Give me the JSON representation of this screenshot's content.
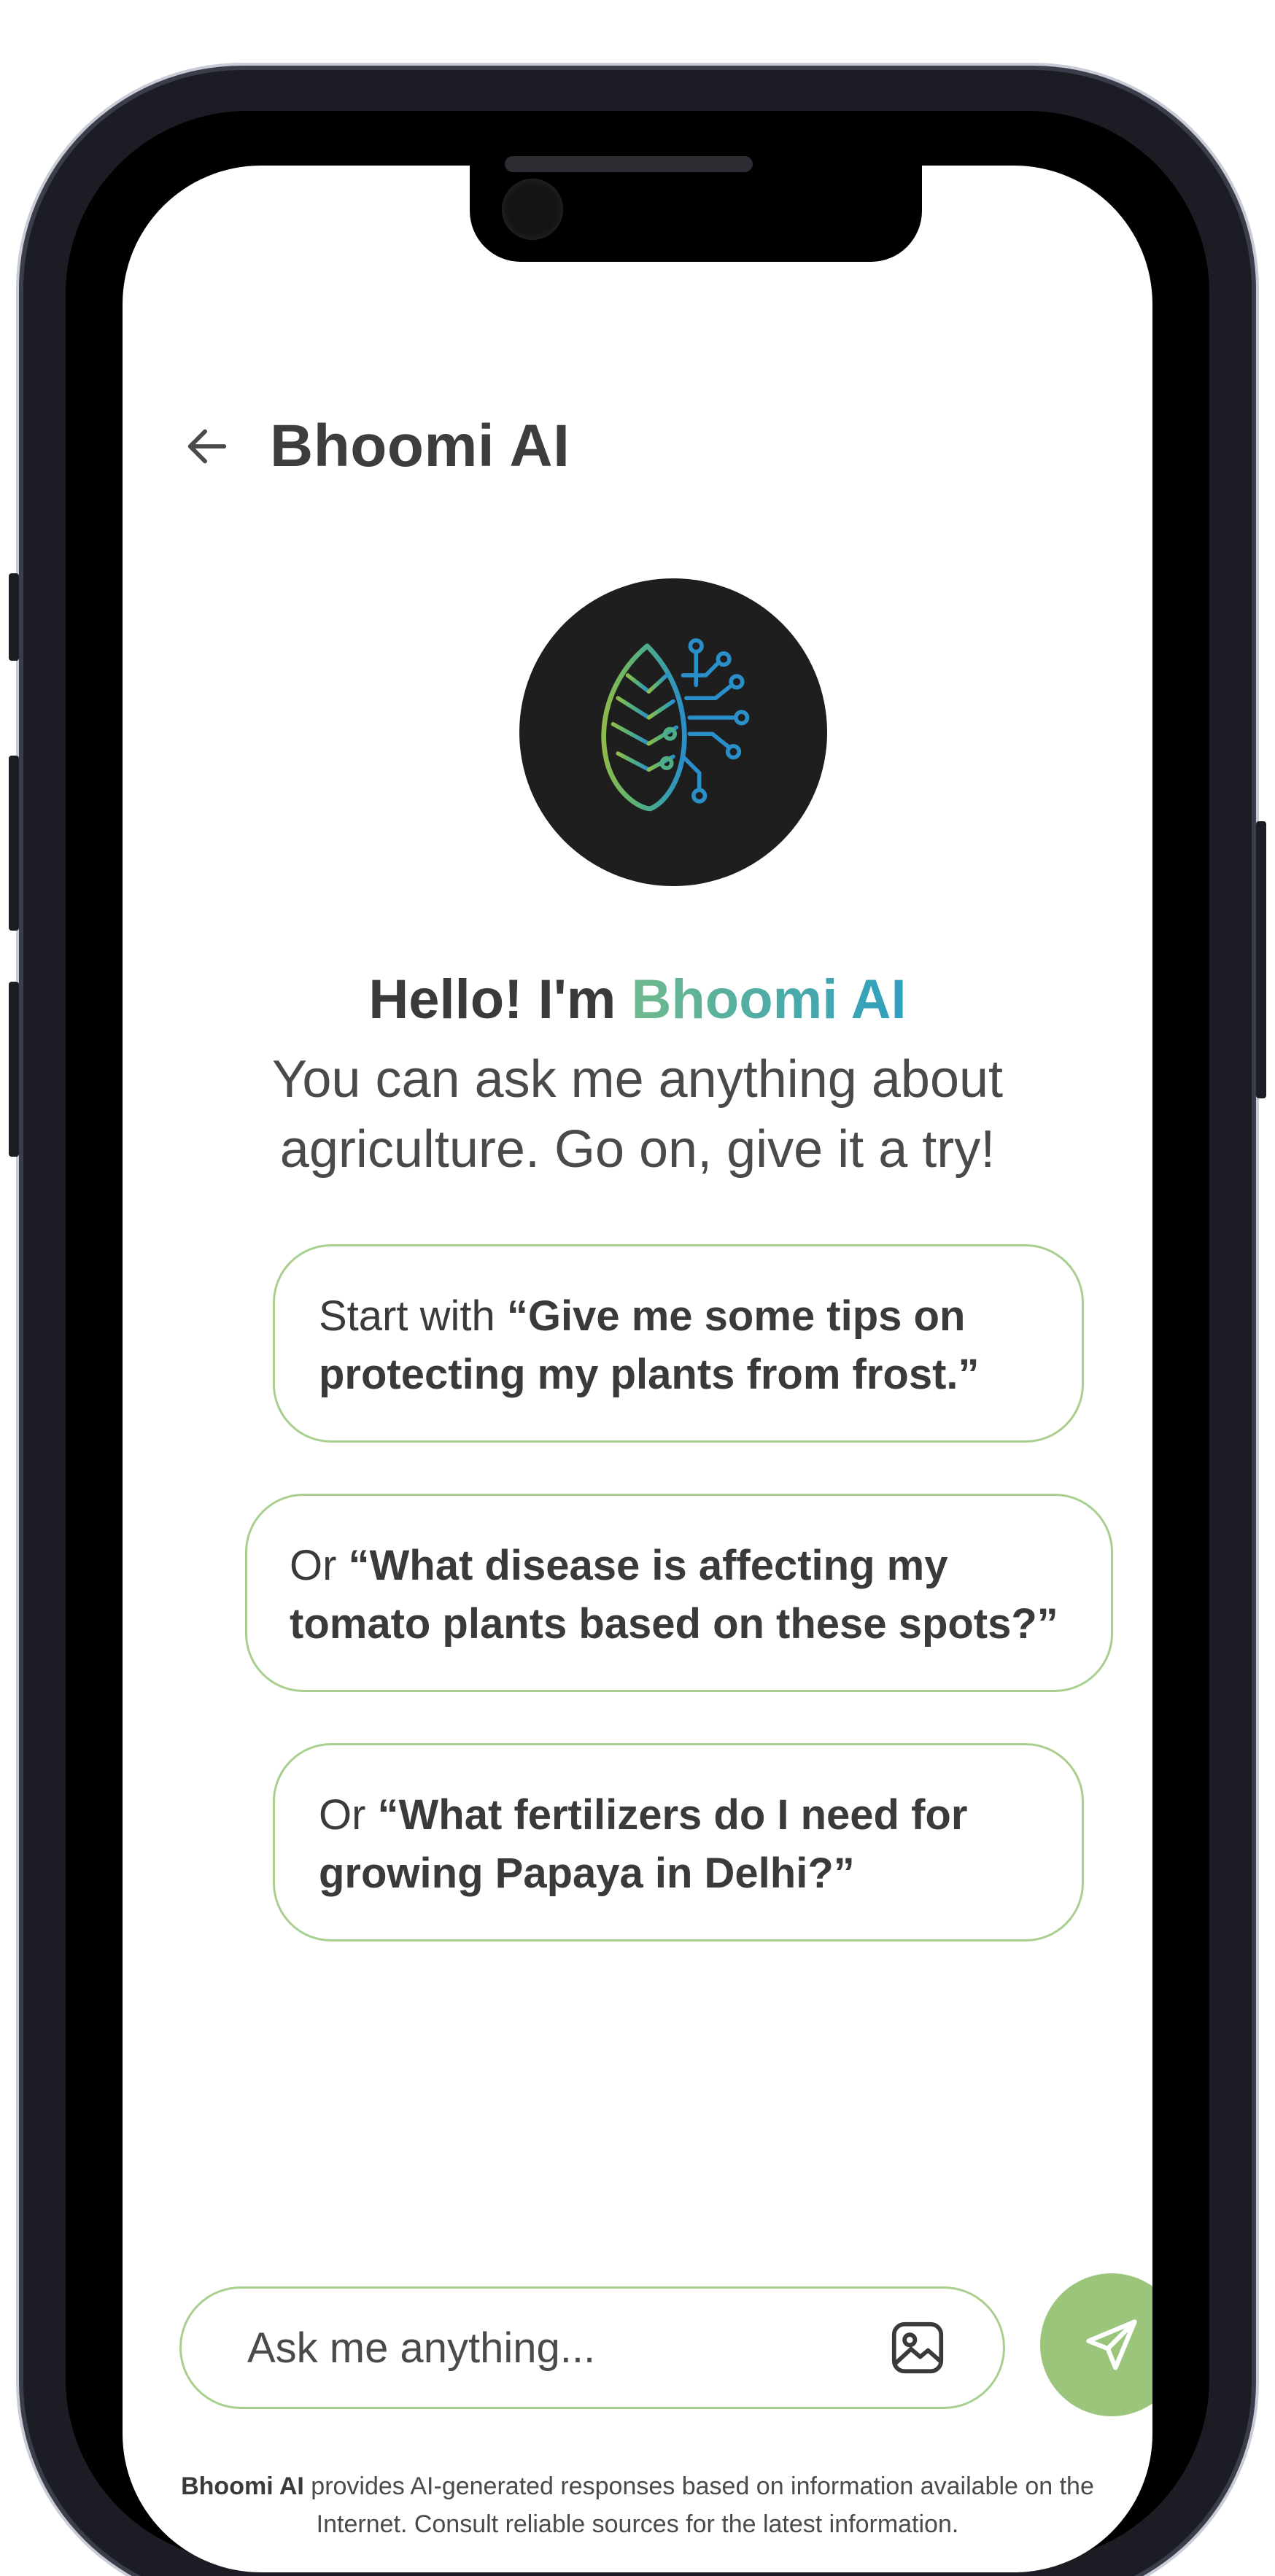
{
  "header": {
    "title": "Bhoomi AI"
  },
  "greeting": {
    "prefix": "Hello! I'm ",
    "brand": "Bhoomi AI",
    "intro": "You can ask me anything about agriculture. Go on, give it a try!"
  },
  "suggestions": [
    {
      "prefix": "Start with ",
      "quote": "“Give me some tips on protecting my plants from frost.”"
    },
    {
      "prefix": "Or ",
      "quote": "“What disease is affecting my tomato plants based on these spots?”"
    },
    {
      "prefix": "Or ",
      "quote": "“What fertilizers do I need for growing Papaya in Delhi?”"
    }
  ],
  "input": {
    "placeholder": "Ask me anything..."
  },
  "disclaimer": {
    "brand": "Bhoomi AI",
    "text": " provides AI-generated responses based on information available on the Internet. Consult reliable sources for the latest information."
  },
  "colors": {
    "accent_green": "#9cc57c",
    "card_border": "#a9cf8e",
    "brand_gradient_start": "#6fb98c",
    "brand_gradient_end": "#2f9fbf",
    "avatar_bg": "#1e1e1e"
  },
  "icons": {
    "back": "arrow-left-icon",
    "logo": "leaf-circuit-logo",
    "image": "image-icon",
    "send": "send-icon"
  }
}
